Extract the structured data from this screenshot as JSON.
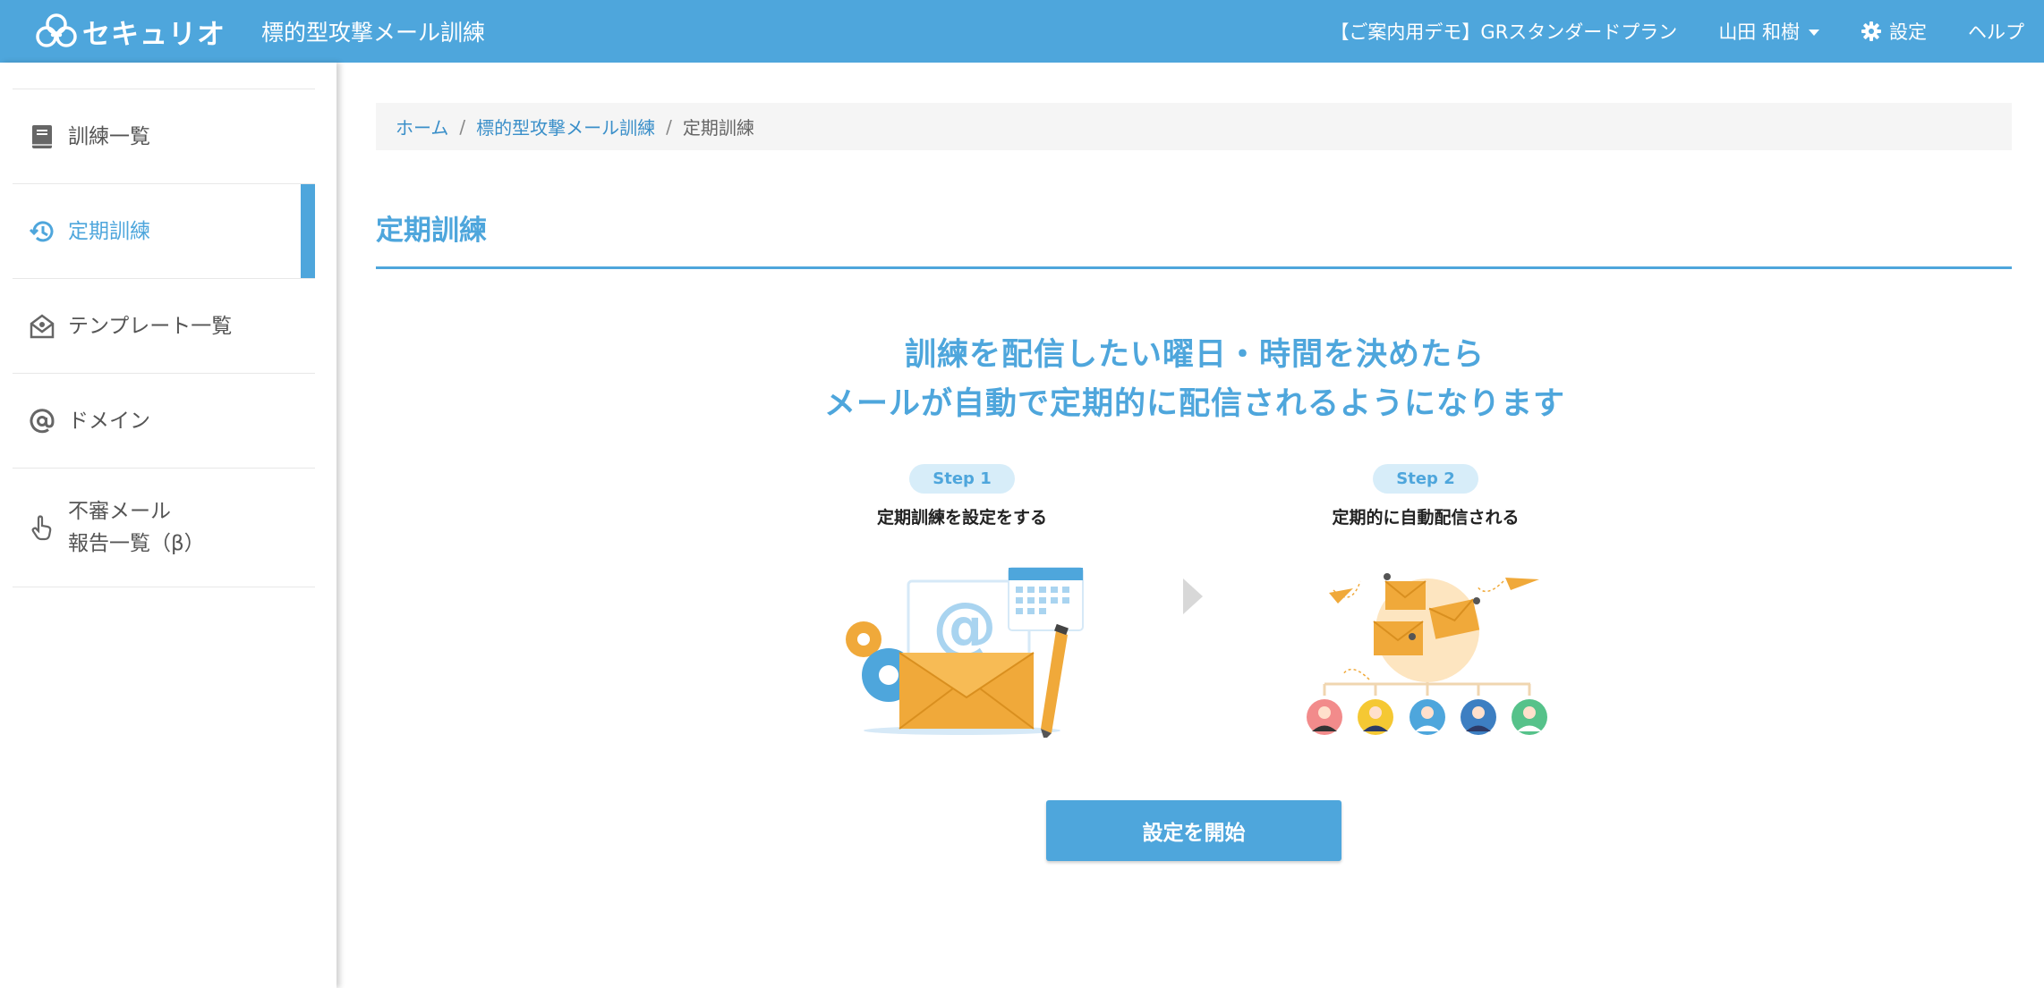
{
  "header": {
    "logo_text": "セキュリオ",
    "app_title": "標的型攻撃メール訓練",
    "plan": "【ご案内用デモ】GRスタンダードプラン",
    "user_name": "山田 和樹",
    "settings_label": "設定",
    "help_label": "ヘルプ"
  },
  "sidebar": {
    "items": [
      {
        "label": "訓練一覧",
        "icon": "book-icon"
      },
      {
        "label": "定期訓練",
        "icon": "history-icon",
        "active": true
      },
      {
        "label": "テンプレート一覧",
        "icon": "envelope-open-icon"
      },
      {
        "label": "ドメイン",
        "icon": "at-icon"
      },
      {
        "label": "不審メール\n報告一覧（β）",
        "icon": "hand-pointer-icon"
      }
    ]
  },
  "breadcrumb": {
    "home": "ホーム",
    "parent": "標的型攻撃メール訓練",
    "current": "定期訓練"
  },
  "page": {
    "title": "定期訓練",
    "headline_line1": "訓練を配信したい曜日・時間を決めたら",
    "headline_line2": "メールが自動で定期的に配信されるようになります"
  },
  "steps": [
    {
      "badge": "Step 1",
      "text": "定期訓練を設定をする"
    },
    {
      "badge": "Step 2",
      "text": "定期的に自動配信される"
    }
  ],
  "illustration": {
    "step1_symbol": "@"
  },
  "cta": {
    "label": "設定を開始"
  },
  "colors": {
    "primary": "#4ea6dc",
    "accent_orange": "#f0a93a"
  }
}
